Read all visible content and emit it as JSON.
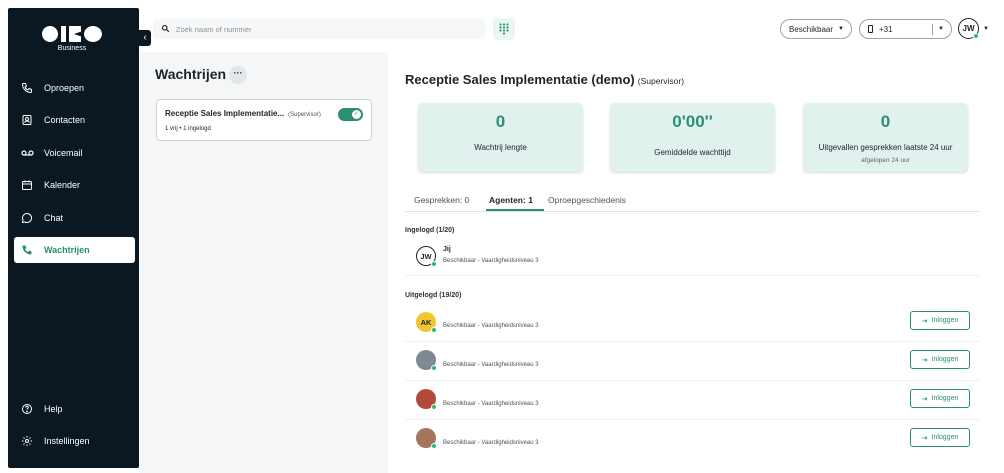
{
  "sidebar": {
    "logo_sub": "Business",
    "items": [
      {
        "label": "Oproepen",
        "icon": "phone-icon"
      },
      {
        "label": "Contacten",
        "icon": "contacts-icon"
      },
      {
        "label": "Voicemail",
        "icon": "voicemail-icon"
      },
      {
        "label": "Kalender",
        "icon": "calendar-icon"
      },
      {
        "label": "Chat",
        "icon": "chat-icon"
      },
      {
        "label": "Wachtrijen",
        "icon": "queue-phone-icon",
        "active": true
      }
    ],
    "bottom": [
      {
        "label": "Help",
        "icon": "help-icon"
      },
      {
        "label": "Instellingen",
        "icon": "settings-icon"
      }
    ]
  },
  "topbar": {
    "search_placeholder": "Zoek naam of nummer",
    "availability": "Beschikbaar",
    "phone_prefix": "+31",
    "user_initials": "JW"
  },
  "queues": {
    "title": "Wachtrijen",
    "more": "···",
    "card": {
      "name": "Receptie Sales Implementatie...",
      "role": "(Supervisor)",
      "meta": "1 vrij • 1 ingelogd",
      "toggle_on": true
    }
  },
  "main": {
    "title": "Receptie Sales Implementatie (demo)",
    "role": "(Supervisor)",
    "stats": [
      {
        "value": "0",
        "label": "Wachtrij lengte",
        "sub": ""
      },
      {
        "value": "0'00''",
        "label": "Gemiddelde wachttijd",
        "sub": ""
      },
      {
        "value": "0",
        "label": "Uitgevallen gesprekken laatste 24 uur",
        "sub": "afgelopen 24 uur"
      }
    ],
    "tabs": [
      {
        "label": "Gesprekken: 0",
        "active": false
      },
      {
        "label": "Agenten: 1",
        "active": true
      },
      {
        "label": "Oproepgeschiedenis",
        "active": false
      }
    ],
    "logged_in_header": "Ingelogd (1/20)",
    "logged_out_header": "Uitgelogd (19/20)",
    "logged_in": [
      {
        "initials": "JW",
        "name": "Jij",
        "status": "Beschikbaar - Vaardigheidsniveau 3"
      }
    ],
    "logged_out": [
      {
        "initials": "AK",
        "status": "Beschikbaar - Vaardigheidsniveau 3",
        "button": "Inloggen"
      },
      {
        "initials": "",
        "status": "Beschikbaar - Vaardigheidsniveau 3",
        "button": "Inloggen"
      },
      {
        "initials": "",
        "status": "Beschikbaar - Vaardigheidsniveau 3",
        "button": "Inloggen"
      },
      {
        "initials": "",
        "status": "Beschikbaar - Vaardigheidsniveau 3",
        "button": "Inloggen"
      }
    ]
  },
  "colors": {
    "accent": "#2c8f74",
    "sidebar": "#0b1822",
    "stat_bg": "#e1f1ee",
    "online": "#2fb57e"
  }
}
